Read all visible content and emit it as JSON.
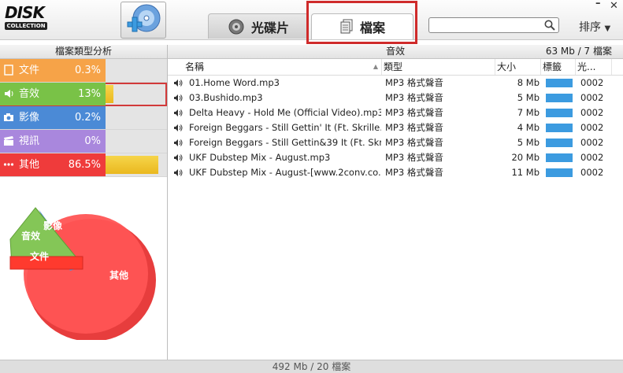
{
  "app": {
    "logo_text": "DISK",
    "logo_sub": "COLLECTION"
  },
  "tabs": [
    {
      "label": "光碟片"
    },
    {
      "label": "檔案"
    }
  ],
  "search": {
    "placeholder": "",
    "value": ""
  },
  "sort_label": "排序",
  "window_controls": {
    "minimize": "–",
    "close": "✕"
  },
  "left_panel": {
    "title": "檔案類型分析",
    "categories": [
      {
        "name": "文件",
        "percent": "0.3%",
        "color": "#f6a348",
        "bar_fraction": 0.0
      },
      {
        "name": "音效",
        "percent": "13%",
        "color": "#79c247",
        "bar_fraction": 0.13
      },
      {
        "name": "影像",
        "percent": "0.2%",
        "color": "#4b8ad6",
        "bar_fraction": 0.0
      },
      {
        "name": "視訊",
        "percent": "0%",
        "color": "#a987dd",
        "bar_fraction": 0.0
      },
      {
        "name": "其他",
        "percent": "86.5%",
        "color": "#ef3b3b",
        "bar_fraction": 0.865
      }
    ],
    "pie_labels": {
      "audio": "音效",
      "image": "影像",
      "doc": "文件",
      "other": "其他"
    }
  },
  "right_panel": {
    "category": "音效",
    "summary": "63 Mb / 7 檔案",
    "columns": [
      "名稱",
      "類型",
      "大小",
      "標籤",
      "光..."
    ],
    "rows": [
      {
        "name": "01.Home Word.mp3",
        "type": "MP3 格式聲音",
        "size": "8 Mb",
        "disc": "0002"
      },
      {
        "name": "03.Bushido.mp3",
        "type": "MP3 格式聲音",
        "size": "5 Mb",
        "disc": "0002"
      },
      {
        "name": "Delta Heavy - Hold Me (Official Video).mp3",
        "type": "MP3 格式聲音",
        "size": "7 Mb",
        "disc": "0002"
      },
      {
        "name": "Foreign Beggars - Still Gettin' It (Ft. Skrille...",
        "type": "MP3 格式聲音",
        "size": "4 Mb",
        "disc": "0002"
      },
      {
        "name": "Foreign Beggars - Still Gettin&39 It (Ft. Skr...",
        "type": "MP3 格式聲音",
        "size": "5 Mb",
        "disc": "0002"
      },
      {
        "name": "UKF Dubstep Mix - August.mp3",
        "type": "MP3 格式聲音",
        "size": "20 Mb",
        "disc": "0002"
      },
      {
        "name": "UKF Dubstep Mix - August-[www.2conv.co...",
        "type": "MP3 格式聲音",
        "size": "11 Mb",
        "disc": "0002"
      }
    ]
  },
  "status_bar": "492 Mb / 20 檔案"
}
